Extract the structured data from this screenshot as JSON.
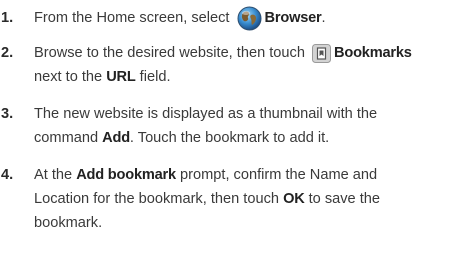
{
  "steps": [
    {
      "number": "1.",
      "lines": [
        {
          "t1": "From the Home screen, select ",
          "b1": "Browser",
          "t2": "."
        }
      ],
      "icon": "globe-icon"
    },
    {
      "number": "2.",
      "lines": [
        {
          "t1": "Browse to the desired website, then touch ",
          "b1": "Bookmarks",
          "t2": ""
        },
        {
          "t1": "next to the ",
          "b1": "URL",
          "t2": " field."
        }
      ],
      "icon": "bookmark-icon"
    },
    {
      "number": "3.",
      "lines": [
        {
          "t1": "The new website is displayed as a thumbnail with the"
        },
        {
          "t1": "command ",
          "b1": "Add",
          "t2": ". Touch the bookmark to add it."
        }
      ]
    },
    {
      "number": "4.",
      "lines": [
        {
          "t1": "At the ",
          "b1": "Add bookmark",
          "t2": " prompt, confirm the Name and"
        },
        {
          "t1": "Location for the bookmark, then touch ",
          "b1": "OK",
          "t2": " to save the"
        },
        {
          "t1": "bookmark."
        }
      ]
    }
  ]
}
